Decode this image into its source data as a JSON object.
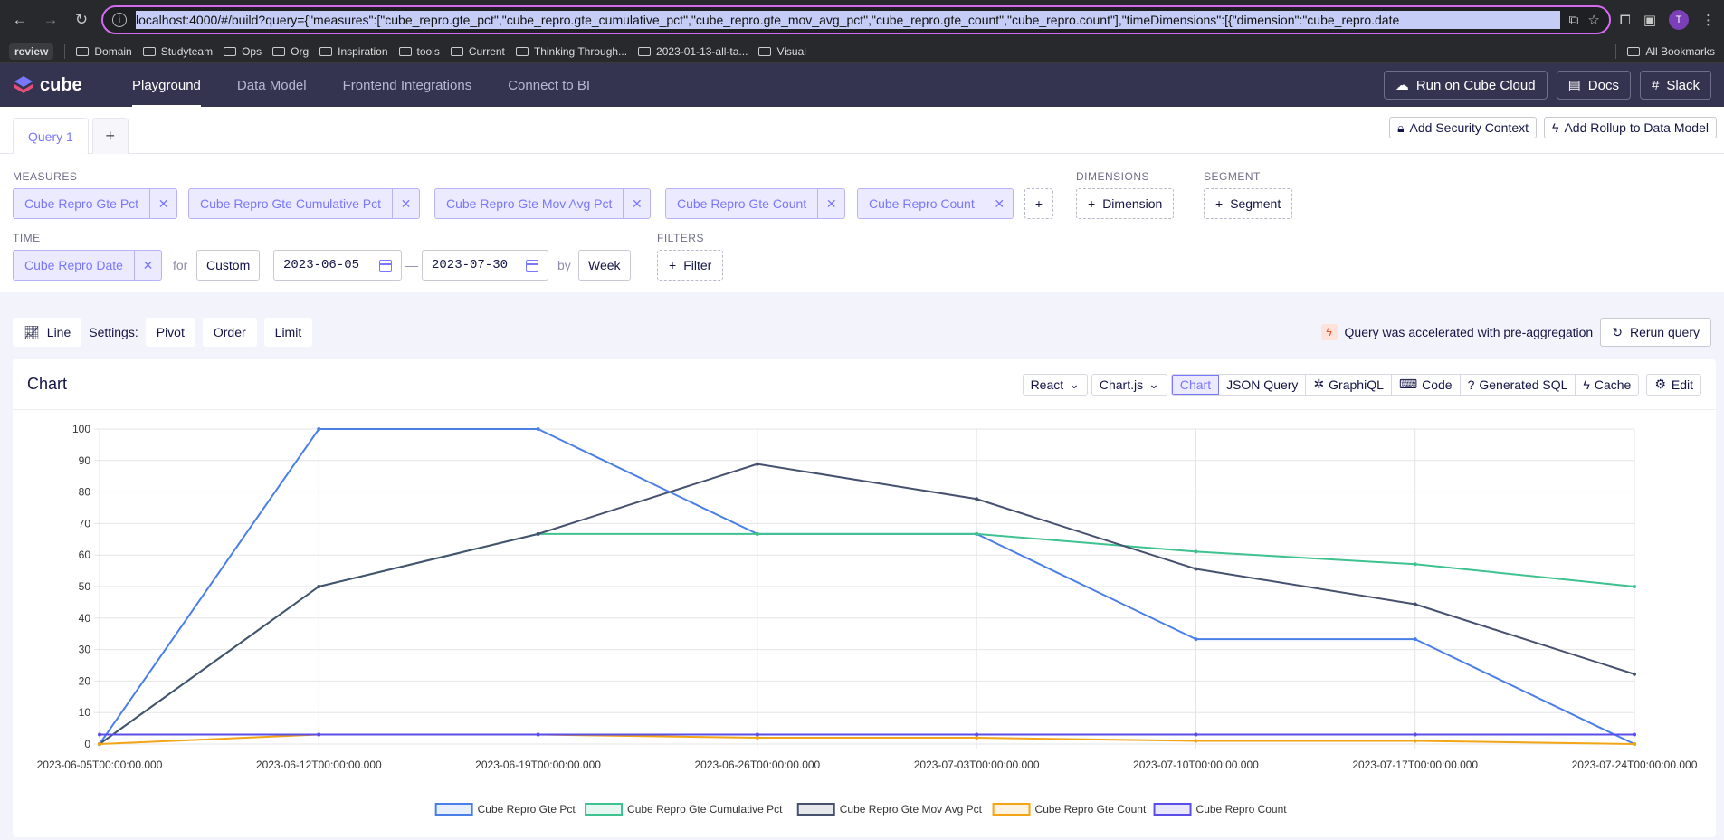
{
  "browser": {
    "url": "localhost:4000/#/build?query={\"measures\":[\"cube_repro.gte_pct\",\"cube_repro.gte_cumulative_pct\",\"cube_repro.gte_mov_avg_pct\",\"cube_repro.gte_count\",\"cube_repro.count\"],\"timeDimensions\":[{\"dimension\":\"cube_repro.date",
    "avatar_letter": "T",
    "bookmarks": [
      "review",
      "Domain",
      "Studyteam",
      "Ops",
      "Org",
      "Inspiration",
      "tools",
      "Current",
      "Thinking Through...",
      "2023-01-13-all-ta...",
      "Visual"
    ],
    "all_bookmarks": "All Bookmarks"
  },
  "app": {
    "logo_text": "cube",
    "nav": [
      "Playground",
      "Data Model",
      "Frontend Integrations",
      "Connect to BI"
    ],
    "run_cloud": "Run on Cube Cloud",
    "docs": "Docs",
    "slack": "Slack"
  },
  "query_tabs": {
    "tab1": "Query 1",
    "add_security": "Add Security Context",
    "add_rollup": "Add Rollup to Data Model"
  },
  "builder": {
    "measures_label": "MEASURES",
    "measures": [
      "Cube Repro Gte Pct",
      "Cube Repro Gte Cumulative Pct",
      "Cube Repro Gte Mov Avg Pct",
      "Cube Repro Gte Count",
      "Cube Repro Count"
    ],
    "dimensions_label": "DIMENSIONS",
    "dimension_btn": "Dimension",
    "segment_label": "SEGMENT",
    "segment_btn": "Segment",
    "time_label": "TIME",
    "time_dimension": "Cube Repro Date",
    "for_text": "for",
    "range": "Custom",
    "date_from": "2023-06-05",
    "date_sep": "—",
    "date_to": "2023-07-30",
    "by_text": "by",
    "granularity": "Week",
    "filters_label": "FILTERS",
    "filter_btn": "Filter"
  },
  "toolbar": {
    "chart_type": "Line",
    "settings": "Settings:",
    "pivot": "Pivot",
    "order": "Order",
    "limit": "Limit",
    "accelerated": "Query was accelerated with pre-aggregation",
    "rerun": "Rerun query"
  },
  "card": {
    "title": "Chart",
    "framework": "React",
    "library": "Chart.js",
    "tabs": [
      "Chart",
      "JSON Query",
      "GraphiQL",
      "Code",
      "Generated SQL",
      "Cache"
    ],
    "edit": "Edit"
  },
  "chart_data": {
    "type": "line",
    "x": [
      "2023-06-05T00:00:00.000",
      "2023-06-12T00:00:00.000",
      "2023-06-19T00:00:00.000",
      "2023-06-26T00:00:00.000",
      "2023-07-03T00:00:00.000",
      "2023-07-10T00:00:00.000",
      "2023-07-17T00:00:00.000",
      "2023-07-24T00:00:00.000"
    ],
    "ylim": [
      0,
      100
    ],
    "yticks": [
      0,
      10,
      20,
      30,
      40,
      50,
      60,
      70,
      80,
      90,
      100
    ],
    "grid": true,
    "legend": "bottom",
    "series": [
      {
        "name": "Cube Repro Gte Pct",
        "color": "#4a7fe8",
        "values": [
          0,
          100,
          100,
          66.7,
          66.7,
          33.3,
          33.3,
          0
        ]
      },
      {
        "name": "Cube Repro Gte Cumulative Pct",
        "color": "#3ec28f",
        "values": [
          0,
          50,
          66.7,
          66.7,
          66.7,
          61.1,
          57.1,
          50
        ]
      },
      {
        "name": "Cube Repro Gte Mov Avg Pct",
        "color": "#46516e",
        "values": [
          0,
          50,
          66.7,
          88.9,
          77.8,
          55.6,
          44.4,
          22.2
        ]
      },
      {
        "name": "Cube Repro Gte Count",
        "color": "#f2a516",
        "values": [
          0,
          3,
          3,
          2,
          2,
          1,
          1,
          0
        ]
      },
      {
        "name": "Cube Repro Count",
        "color": "#5a4de8",
        "values": [
          3,
          3,
          3,
          3,
          3,
          3,
          3,
          3
        ]
      }
    ]
  }
}
